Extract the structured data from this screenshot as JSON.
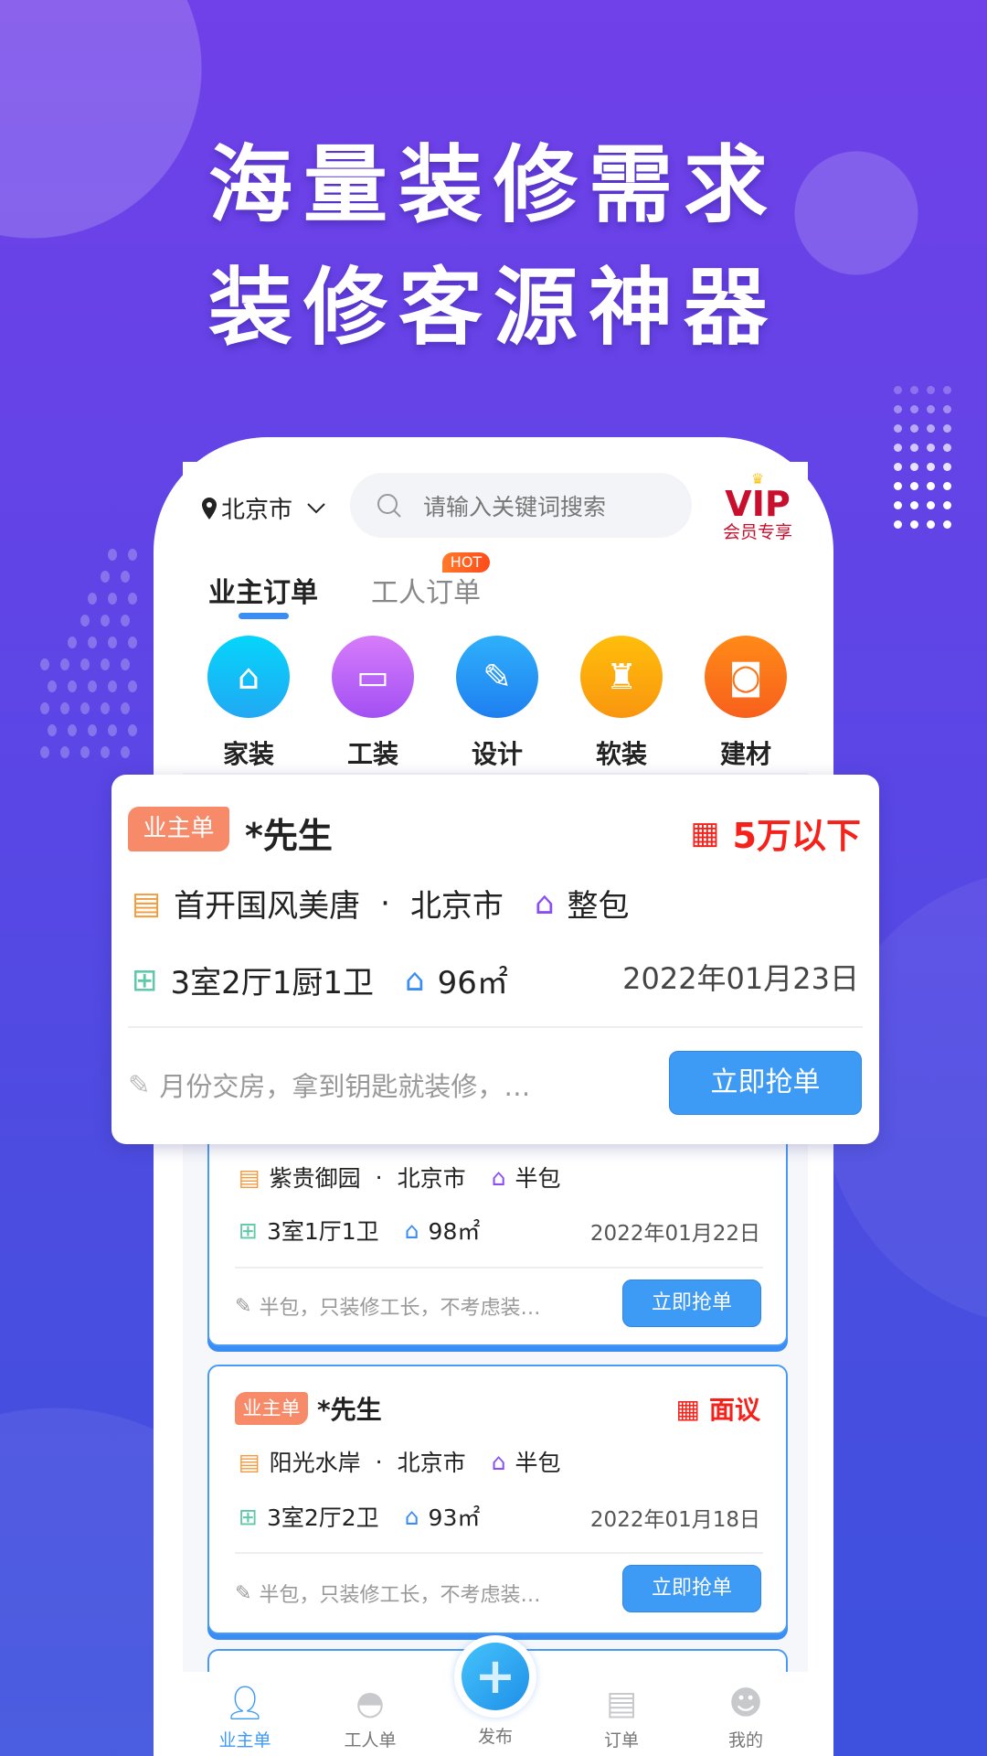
{
  "headline": {
    "line1": "海量装修需求",
    "line2": "装修客源神器"
  },
  "topbar": {
    "city": "北京市",
    "search_placeholder": "请输入关键词搜索",
    "vip_title": "VIP",
    "vip_subtitle": "会员专享"
  },
  "tabs": [
    {
      "label": "业主订单",
      "active": true
    },
    {
      "label": "工人订单",
      "badge": "HOT"
    }
  ],
  "categories": [
    {
      "label": "家装",
      "icon": "house-leaf-icon",
      "color": "#14b8f5"
    },
    {
      "label": "工装",
      "icon": "paint-roller-icon",
      "color": "#b05ef5"
    },
    {
      "label": "设计",
      "icon": "ruler-pencil-icon",
      "color": "#2b8cf5"
    },
    {
      "label": "软装",
      "icon": "sofa-icon",
      "color": "#fba80f"
    },
    {
      "label": "建材",
      "icon": "paint-bucket-icon",
      "color": "#fb6c18"
    }
  ],
  "orders": [
    {
      "tag": "业主单",
      "name": "*先生",
      "budget": "5万以下",
      "community": "首开国风美唐",
      "city": "北京市",
      "package": "整包",
      "layout": "3室2厅1厨1卫",
      "area": "96㎡",
      "date": "2022年01月23日",
      "note": "月份交房，拿到钥匙就装修，…",
      "action": "立即抢单"
    },
    {
      "community": "紫贵御园",
      "city": "北京市",
      "package": "半包",
      "layout": "3室1厅1卫",
      "area": "98㎡",
      "date": "2022年01月22日",
      "note": "半包，只装修工长，不考虑装…",
      "action": "立即抢单"
    },
    {
      "tag": "业主单",
      "name": "*先生",
      "budget": "面议",
      "community": "阳光水岸",
      "city": "北京市",
      "package": "半包",
      "layout": "3室2厅2卫",
      "area": "93㎡",
      "date": "2022年01月18日",
      "note": "半包，只装修工长，不考虑装…",
      "action": "立即抢单"
    }
  ],
  "separator": "·",
  "bottom_nav": [
    {
      "label": "业主单",
      "icon": "owner-icon",
      "active": true
    },
    {
      "label": "工人单",
      "icon": "worker-helmet-icon"
    },
    {
      "label": "发布",
      "icon": "plus-icon"
    },
    {
      "label": "订单",
      "icon": "order-scroll-icon"
    },
    {
      "label": "我的",
      "icon": "profile-icon"
    }
  ],
  "colors": {
    "accent": "#3d9af5",
    "price": "#f5221b",
    "tag": "#f78a68",
    "background_top": "#7040e8",
    "background_bottom": "#3d51de"
  }
}
